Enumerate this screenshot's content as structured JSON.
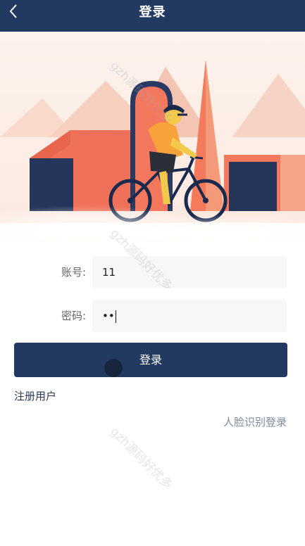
{
  "header": {
    "title": "登录",
    "back_icon": "chevron-left-icon"
  },
  "form": {
    "account_label": "账号:",
    "account_value": "11",
    "password_label": "密码:",
    "password_value": "••"
  },
  "actions": {
    "login_label": "登录",
    "register_label": "注册用户",
    "face_login_label": "人脸识别登录"
  },
  "watermark": {
    "text": "gzh源码好优多"
  },
  "colors": {
    "primary": "#223a61",
    "illustration_coral": "#f26b4f",
    "illustration_navy": "#25365a",
    "illustration_peach": "#fbe6da"
  }
}
